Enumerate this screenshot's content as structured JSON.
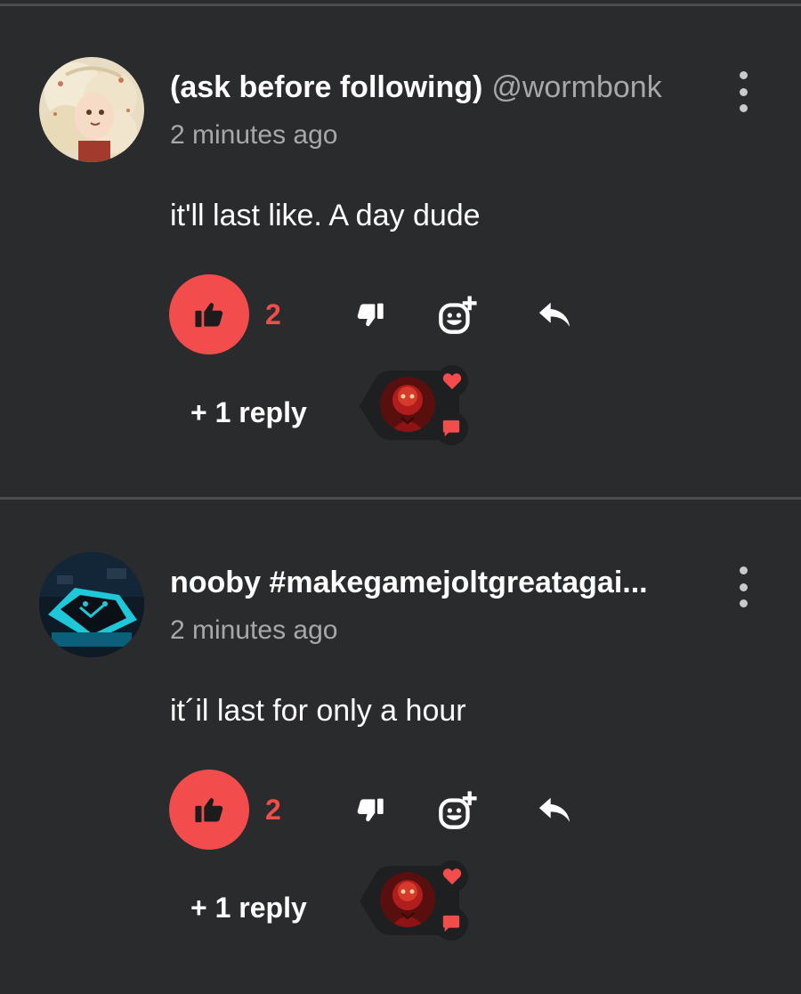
{
  "comments": [
    {
      "display_name": "(ask before following)",
      "handle": "@wormbonk",
      "timestamp": "2 minutes ago",
      "body": "it'll last like. A day dude",
      "like_count": "2",
      "replies_label": "+ 1 reply",
      "liked": true
    },
    {
      "display_name": "nooby #makegamejoltgreatagai...",
      "handle": "",
      "timestamp": "2 minutes ago",
      "body": "it´il last for only a hour",
      "like_count": "2",
      "replies_label": "+ 1 reply",
      "liked": true
    }
  ],
  "colors": {
    "background": "#292b2d",
    "accent": "#f34c4d",
    "muted_text": "#a6a8aa",
    "divider": "#4a4c4e"
  },
  "icons": {
    "like": "thumbs-up-icon",
    "dislike": "thumbs-down-icon",
    "reaction": "add-reaction-icon",
    "reply": "reply-arrow-icon",
    "more": "more-vertical-icon",
    "heart": "heart-icon",
    "chat": "chat-bubble-icon"
  }
}
